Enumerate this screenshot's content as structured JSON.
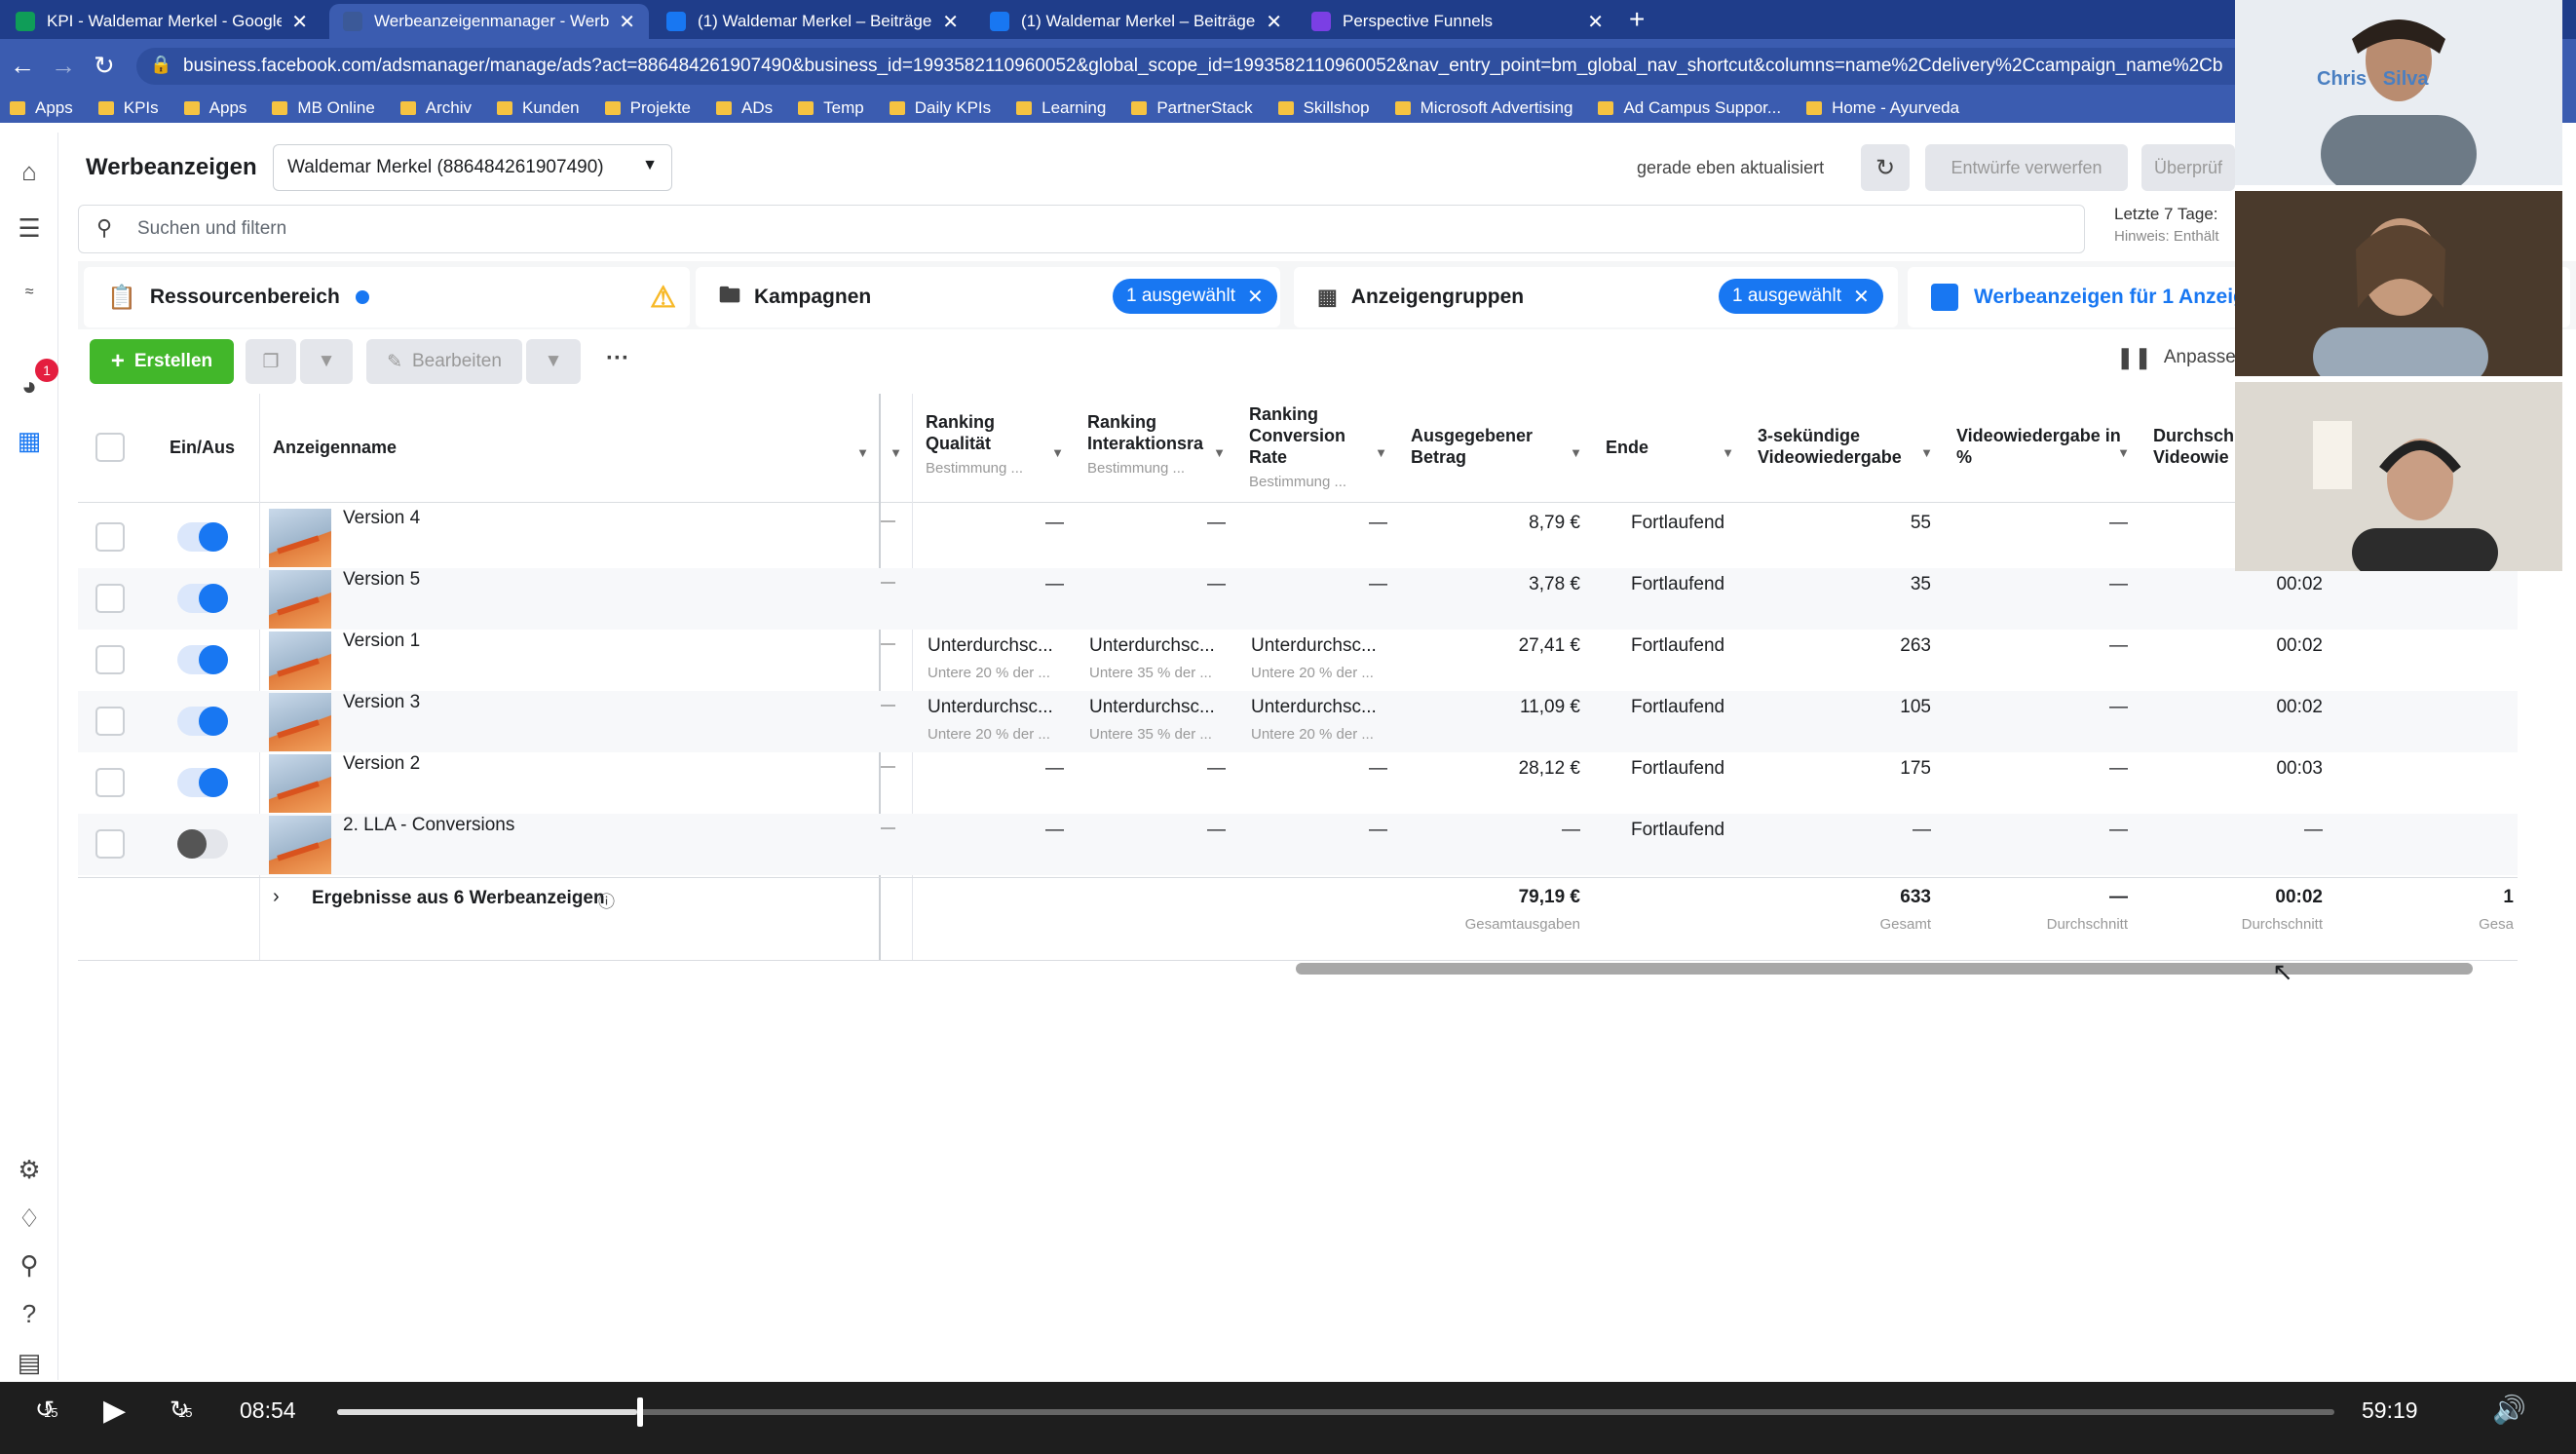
{
  "browser": {
    "tabs": [
      {
        "title": "KPI - Waldemar Merkel - Google",
        "favicon": "sheets-icon",
        "color": "#0f9d58"
      },
      {
        "title": "Werbeanzeigenmanager - Werbe",
        "favicon": "meta-ads-icon",
        "color": "#3b5998"
      },
      {
        "title": "(1) Waldemar Merkel – Beiträge",
        "favicon": "facebook-icon",
        "color": "#1877f2"
      },
      {
        "title": "(1) Waldemar Merkel – Beiträge",
        "favicon": "facebook-icon",
        "color": "#1877f2"
      },
      {
        "title": "Perspective Funnels",
        "favicon": "perspective-icon",
        "color": "#7b3fe4"
      }
    ],
    "url": "business.facebook.com/adsmanager/manage/ads?act=886484261907490&business_id=1993582110960052&global_scope_id=1993582110960052&nav_entry_point=bm_global_nav_shortcut&columns=name%2Cdelivery%2Ccampaign_name%2Cb",
    "bookmarks": [
      "Apps",
      "KPIs",
      "Apps",
      "MB Online",
      "Archiv",
      "Kunden",
      "Projekte",
      "ADs",
      "Temp",
      "Daily KPIs",
      "Learning",
      "PartnerStack",
      "Skillshop",
      "Microsoft Advertising",
      "Ad Campus Suppor...",
      "Home - Ayurveda"
    ]
  },
  "rail": {
    "notification_count": "1"
  },
  "header": {
    "title": "Werbeanzeigen",
    "account": "Waldemar Merkel (886484261907490)",
    "updated": "gerade eben aktualisiert",
    "discard_drafts": "Entwürfe verwerfen",
    "review": "Überprüf"
  },
  "search": {
    "placeholder": "Suchen und filtern"
  },
  "daterange": {
    "label": "Letzte 7 Tage:",
    "hint": "Hinweis: Enthält"
  },
  "resource_tabs": {
    "resources": "Ressourcenbereich",
    "campaigns": "Kampagnen",
    "campaigns_selected": "1 ausgewählt",
    "adsets": "Anzeigengruppen",
    "adsets_selected": "1 ausgewählt",
    "ads": "Werbeanzeigen für 1 Anzeig"
  },
  "toolbar": {
    "create": "Erstellen",
    "edit": "Bearbeiten",
    "more": "···",
    "customize": "Anpassen"
  },
  "columns": {
    "onoff": "Ein/Aus",
    "name": "Anzeigenname",
    "ranking_quality": "Ranking Qualität",
    "ranking_quality_sub": "Bestimmung ...",
    "ranking_interaction": "Ranking Interaktionsra",
    "ranking_interaction_sub": "Bestimmung ...",
    "ranking_conversion": "Ranking Conversion Rate",
    "ranking_conversion_sub": "Bestimmung ...",
    "spent": "Ausgegebener Betrag",
    "end": "Ende",
    "video3s": "3-sekündige Videowiedergabe",
    "video_pct": "Videowiedergabe in %",
    "avg_video": "Durchschn Videowie"
  },
  "rows": [
    {
      "name": "Version 4",
      "on": true,
      "rq": "—",
      "rq_sub": "",
      "ri": "—",
      "ri_sub": "",
      "rc": "—",
      "rc_sub": "",
      "spent": "8,79 €",
      "end": "Fortlaufend",
      "v3": "55",
      "vpct": "—",
      "avg": ""
    },
    {
      "name": "Version 5",
      "on": true,
      "rq": "—",
      "rq_sub": "",
      "ri": "—",
      "ri_sub": "",
      "rc": "—",
      "rc_sub": "",
      "spent": "3,78 €",
      "end": "Fortlaufend",
      "v3": "35",
      "vpct": "—",
      "avg": "00:02"
    },
    {
      "name": "Version 1",
      "on": true,
      "rq": "Unterdurchsc...",
      "rq_sub": "Untere 20 % der ...",
      "ri": "Unterdurchsc...",
      "ri_sub": "Untere 35 % der ...",
      "rc": "Unterdurchsc...",
      "rc_sub": "Untere 20 % der ...",
      "spent": "27,41 €",
      "end": "Fortlaufend",
      "v3": "263",
      "vpct": "—",
      "avg": "00:02"
    },
    {
      "name": "Version 3",
      "on": true,
      "rq": "Unterdurchsc...",
      "rq_sub": "Untere 20 % der ...",
      "ri": "Unterdurchsc...",
      "ri_sub": "Untere 35 % der ...",
      "rc": "Unterdurchsc...",
      "rc_sub": "Untere 20 % der ...",
      "spent": "11,09 €",
      "end": "Fortlaufend",
      "v3": "105",
      "vpct": "—",
      "avg": "00:02"
    },
    {
      "name": "Version 2",
      "on": true,
      "rq": "—",
      "rq_sub": "",
      "ri": "—",
      "ri_sub": "",
      "rc": "—",
      "rc_sub": "",
      "spent": "28,12 €",
      "end": "Fortlaufend",
      "v3": "175",
      "vpct": "—",
      "avg": "00:03"
    },
    {
      "name": "2. LLA - Conversions",
      "on": false,
      "rq": "—",
      "rq_sub": "",
      "ri": "—",
      "ri_sub": "",
      "rc": "—",
      "rc_sub": "",
      "spent": "—",
      "end": "Fortlaufend",
      "v3": "—",
      "vpct": "—",
      "avg": "—"
    }
  ],
  "summary": {
    "label": "Ergebnisse aus 6 Werbeanzeigen",
    "spent": "79,19 €",
    "spent_lbl": "Gesamtausgaben",
    "v3": "633",
    "v3_lbl": "Gesamt",
    "vpct": "—",
    "vpct_lbl": "Durchschnitt",
    "avg": "00:02",
    "avg_lbl": "Durchschnitt",
    "extra": "1",
    "extra_lbl": "Gesa"
  },
  "video_call": {
    "participant_1_logo": "Chris   Silva"
  },
  "player": {
    "current": "08:54",
    "total": "59:19",
    "skip_back": "15",
    "skip_fwd": "15",
    "progress": 0.15
  }
}
